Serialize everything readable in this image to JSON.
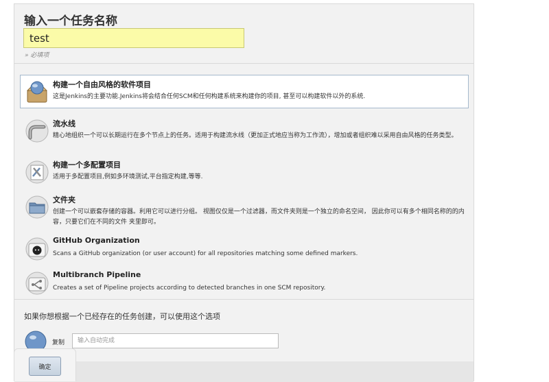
{
  "name_section": {
    "heading": "输入一个任务名称",
    "value": "test",
    "required_note": "» 必填项"
  },
  "items": [
    {
      "title": "构建一个自由风格的软件项目",
      "desc": "这是Jenkins的主要功能.Jenkins将会结合任何SCM和任何构建系统来构建你的项目, 甚至可以构建软件以外的系统.",
      "icon": "freestyle-project-icon",
      "selected": true
    },
    {
      "title": "流水线",
      "desc": "精心地组织一个可以长期运行在多个节点上的任务。适用于构建流水线（更加正式地应当称为工作流），增加或者组织难以采用自由风格的任务类型。",
      "icon": "pipeline-icon",
      "selected": false
    },
    {
      "title": "构建一个多配置项目",
      "desc": "适用于多配置项目,例如多环境测试,平台指定构建,等等.",
      "icon": "multi-configuration-icon",
      "selected": false
    },
    {
      "title": "文件夹",
      "desc": "创建一个可以嵌套存储的容器。利用它可以进行分组。 视图仅仅是一个过滤器，而文件夹则是一个独立的命名空间， 因此你可以有多个相同名称的的内容，只要它们在不同的文件 夹里即可。",
      "icon": "folder-icon",
      "selected": false
    },
    {
      "title": "GitHub Organization",
      "desc": "Scans a GitHub organization (or user account) for all repositories matching some defined markers.",
      "icon": "github-organization-icon",
      "selected": false
    },
    {
      "title": "Multibranch Pipeline",
      "desc": "Creates a set of Pipeline projects according to detected branches in one SCM repository.",
      "icon": "multibranch-pipeline-icon",
      "selected": false
    }
  ],
  "copy_section": {
    "heading": "如果你想根据一个已经存在的任务创建，可以使用这个选项",
    "label": "复制",
    "placeholder": "输入自动完成"
  },
  "ok_button": {
    "label": "确定"
  },
  "colors": {
    "name_input_bg": "#fbfba8",
    "selected_border": "#a4b8cc",
    "panel_bg": "#f2f2f2"
  }
}
